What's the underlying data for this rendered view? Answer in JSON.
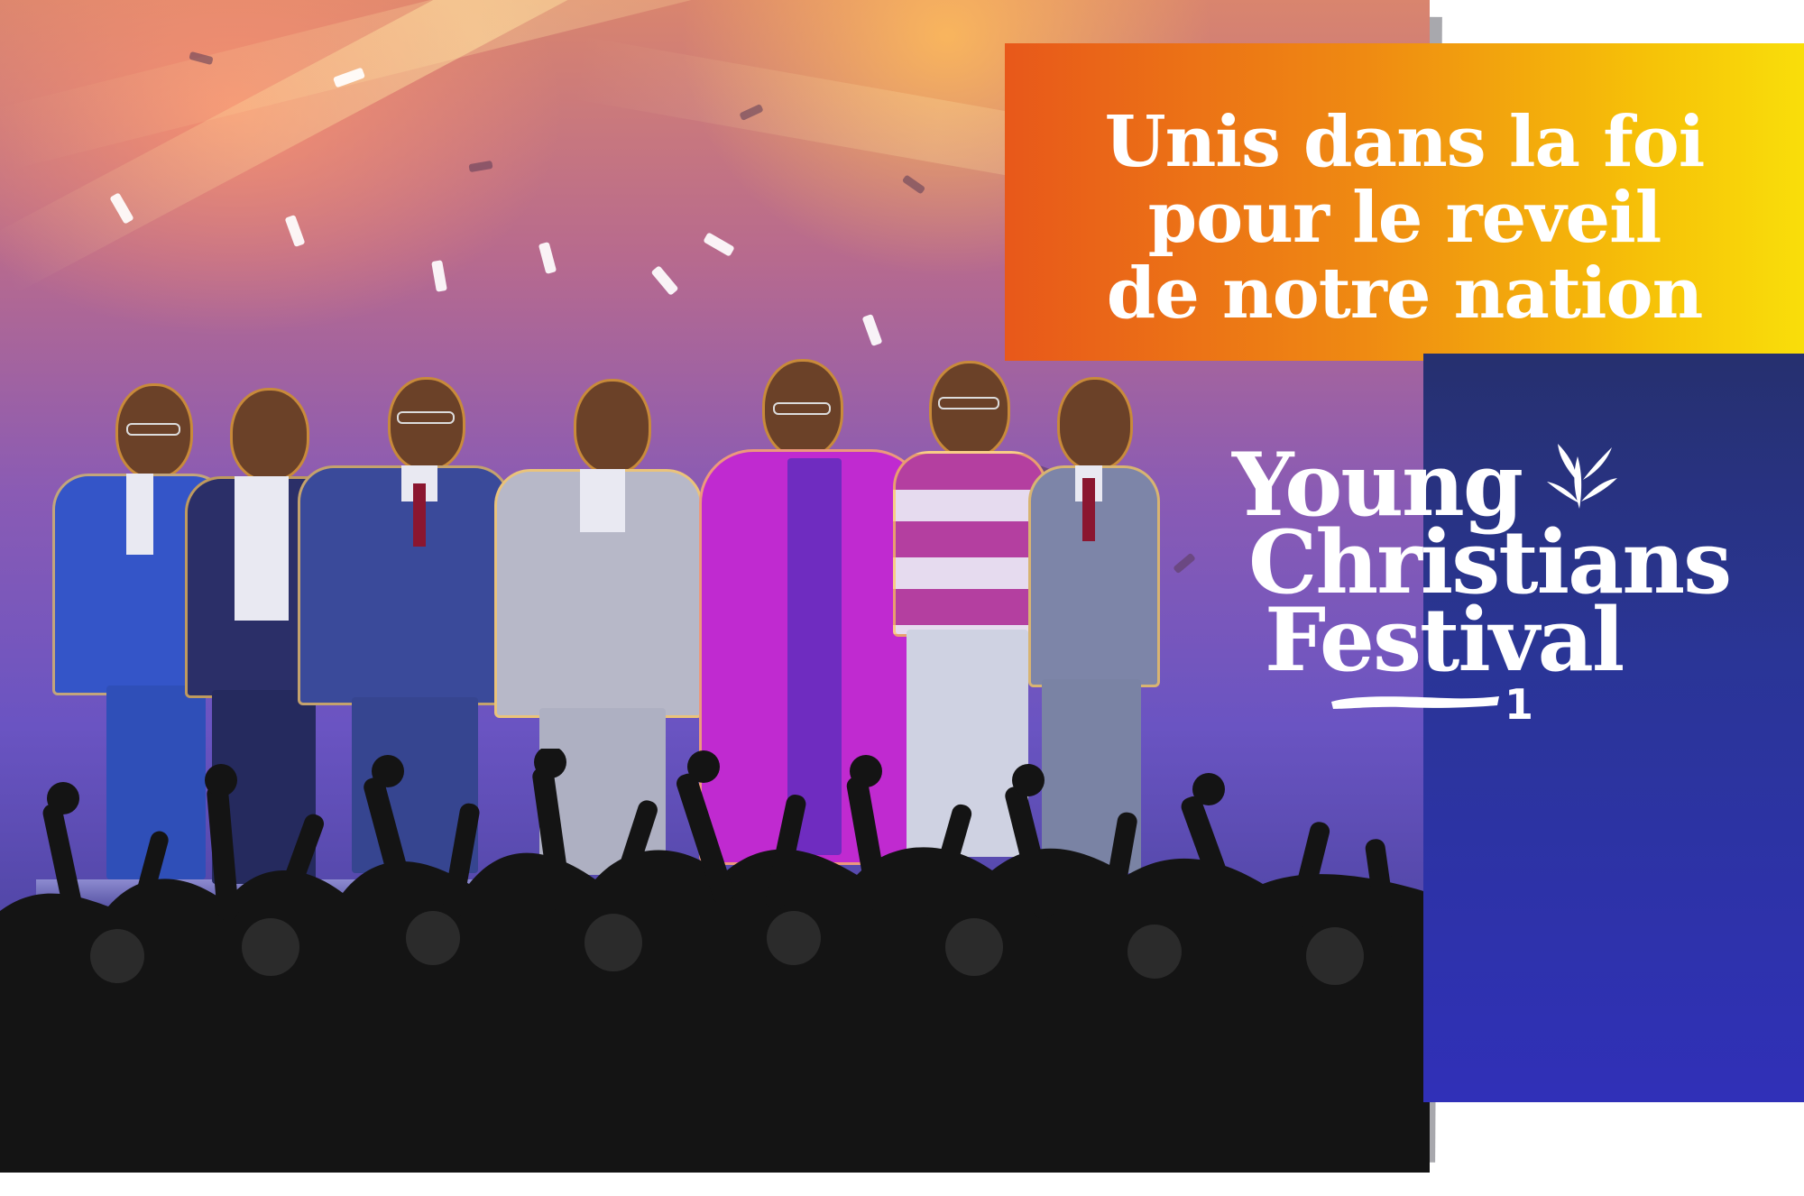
{
  "banner": {
    "lines": [
      "Unis dans la foi",
      "pour le reveil",
      "de notre nation"
    ]
  },
  "logo": {
    "line1": "Young",
    "line2": "Christians",
    "line3": "Festival",
    "edition": "1",
    "icon": "leaf-icon"
  },
  "colors": {
    "banner_start": "#e8581a",
    "banner_end": "#f9de0a",
    "logo_panel": "#2a3596",
    "priest_robe": "#c02ad0"
  }
}
